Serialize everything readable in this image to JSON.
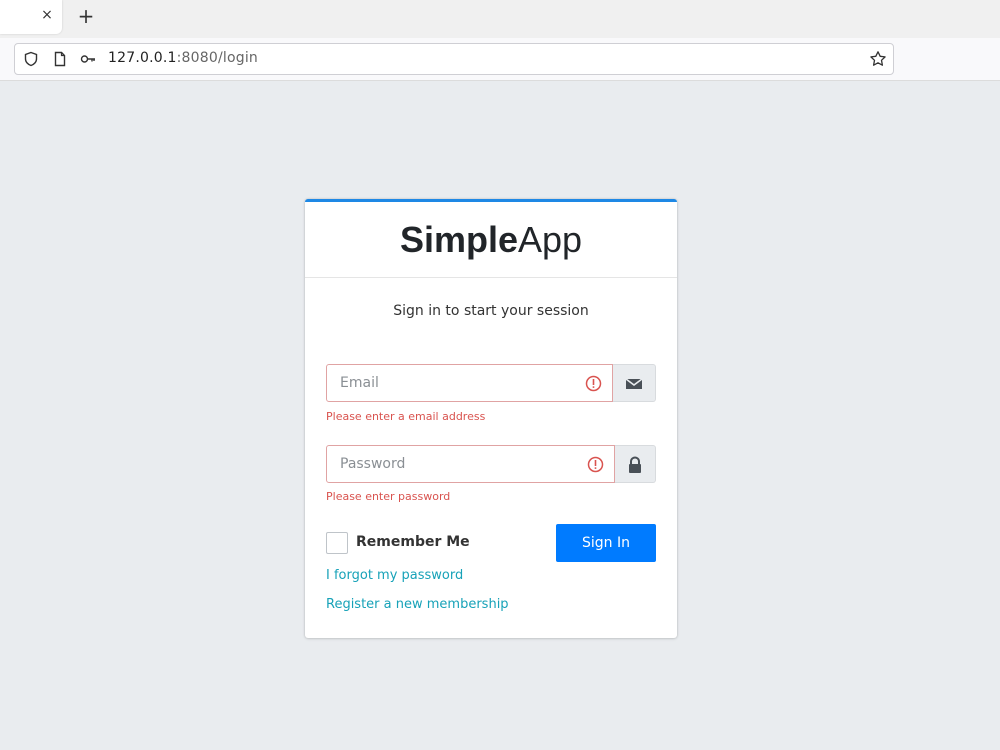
{
  "browser": {
    "tab_close": "×",
    "new_tab": "+",
    "url_host": "127.0.0.1",
    "url_path": ":8080/login"
  },
  "login": {
    "logo_bold": "Simple",
    "logo_light": "App",
    "subtitle": "Sign in to start your session",
    "email": {
      "placeholder": "Email",
      "value": "",
      "error": "Please enter a email address"
    },
    "password": {
      "placeholder": "Password",
      "value": "",
      "error": "Please enter password"
    },
    "remember_label": "Remember Me",
    "remember_checked": false,
    "signin_label": "Sign In",
    "forgot_link": "I forgot my password",
    "register_link": "Register a new membership"
  },
  "colors": {
    "accent": "#007bff",
    "card_top_border": "#1e88e5",
    "error": "#d9534f",
    "link": "#17a2b8",
    "background": "#e9ecef"
  },
  "icons": {
    "email_addon": "envelope-icon",
    "password_addon": "lock-icon",
    "error": "exclamation-circle-icon"
  }
}
